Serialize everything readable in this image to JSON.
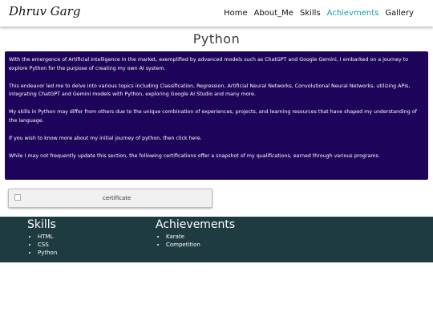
{
  "nav": {
    "brand": "Dhruv Garg",
    "links": [
      "Home",
      "About_Me",
      "Skills",
      "Achievments",
      "Gallery"
    ],
    "active": "Achievments"
  },
  "page": {
    "title": "Python",
    "paragraphs": [
      "With the emergence of Artificial Intelligence in the market, exemplified by advanced models such as ChatGPT and Google Gemini, I embarked on a journey to explore Python for the purpose of creating my own AI system.",
      "This endeavor led me to delve into various topics including Classification, Regression, Artificial Neural Networks, Convolutional Neural Networks, utilizing APIs, integrating ChatGPT and Gemini models with Python, exploring Google AI Studio and many more.",
      "My skills in Python may differ from others due to the unique combination of experiences, projects, and learning resources that have shaped my understanding of the language.",
      "If you wish to know more about my initial journey of python, then click here.",
      "While I may not frequently update this section, the following certifications offer a snapshot of my qualifications, earned through various programs."
    ],
    "certificate_alt": "certificate"
  },
  "footer": {
    "skills_title": "Skills",
    "skills": [
      "HTML",
      "CSS",
      "Python"
    ],
    "achievements_title": "Achievements",
    "achievements": [
      "Karate",
      "Competition"
    ]
  },
  "colors": {
    "content_bg": "#1e035a",
    "footer_bg": "#1e3b42",
    "active_link": "#1a9aa6"
  }
}
